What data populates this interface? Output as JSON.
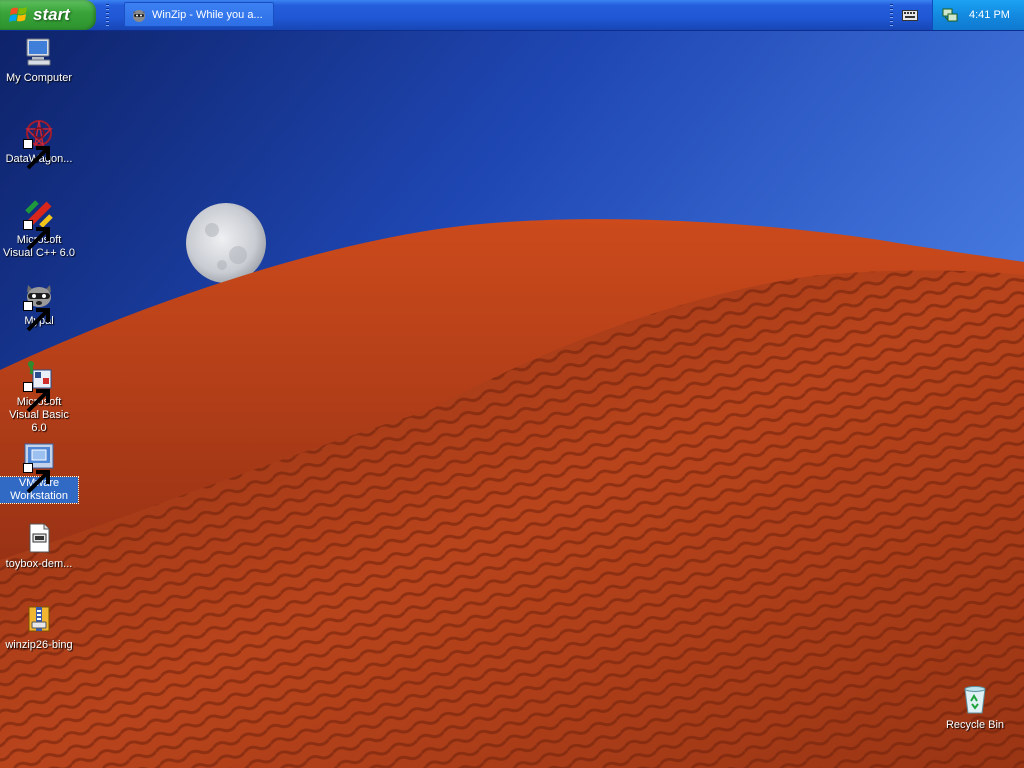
{
  "taskbar": {
    "start_label": "start",
    "task_title": "WinZip - While you a...",
    "clock": "4:41 PM"
  },
  "desktop": {
    "icons": [
      {
        "label": "My Computer",
        "icon": "my-computer-icon",
        "selected": false
      },
      {
        "label": "DataWagon...",
        "icon": "datawagon-icon",
        "selected": false
      },
      {
        "label": "Microsoft Visual C++ 6.0",
        "icon": "visual-cpp-icon",
        "selected": false
      },
      {
        "label": "Mypal",
        "icon": "mypal-raccoon-icon",
        "selected": false
      },
      {
        "label": "Microsoft Visual Basic 6.0",
        "icon": "visual-basic-icon",
        "selected": false
      },
      {
        "label": "VMware Workstation",
        "icon": "vmware-icon",
        "selected": true
      },
      {
        "label": "toybox-dem...",
        "icon": "toybox-document-icon",
        "selected": false
      },
      {
        "label": "winzip26-bing",
        "icon": "winzip-installer-icon",
        "selected": false
      }
    ],
    "recycle_bin": {
      "label": "Recycle Bin",
      "icon": "recycle-bin-icon"
    }
  },
  "colors": {
    "taskbar_blue": "#245edb",
    "start_green": "#3aa53a",
    "tray_blue": "#138ae0",
    "selection_blue": "#316ac5",
    "sky_top": "#0f2a7e",
    "sand": "#b3411a"
  }
}
